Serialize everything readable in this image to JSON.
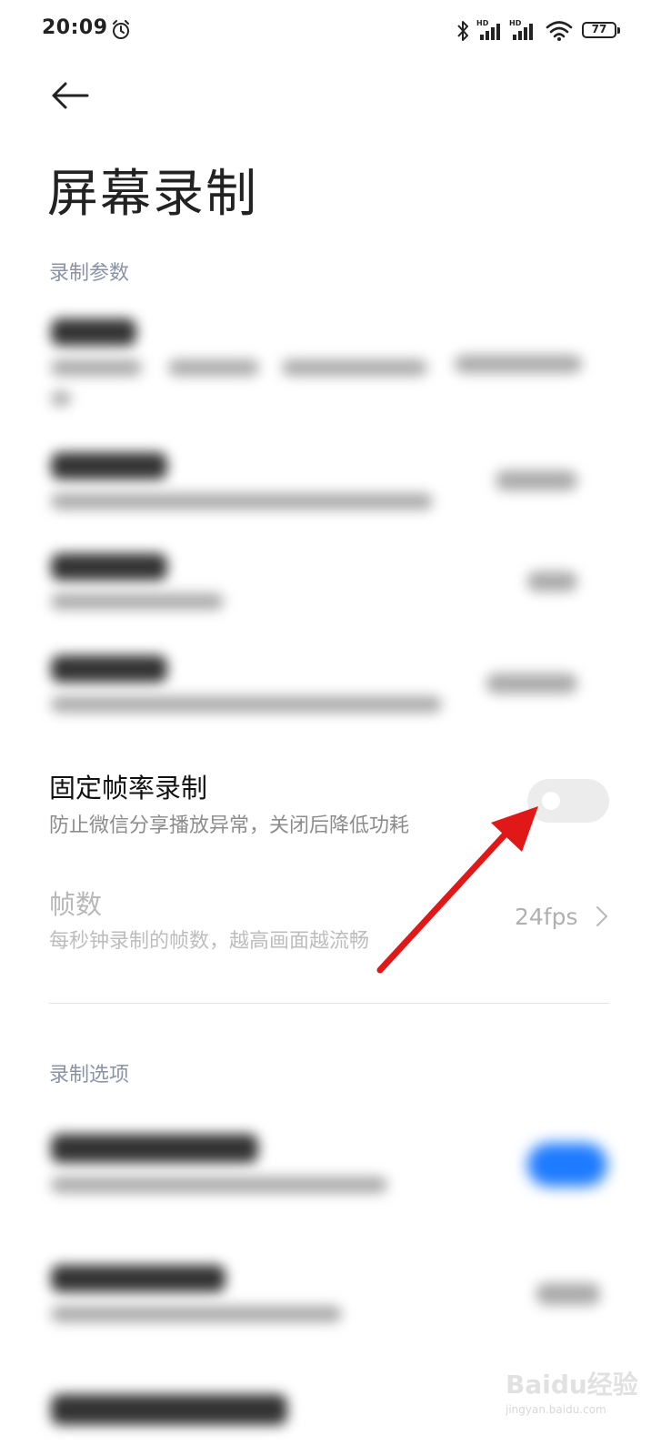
{
  "status_bar": {
    "time": "20:09",
    "battery_level": "77",
    "icons": [
      "alarm-icon",
      "bluetooth-icon",
      "signal-hd-icon",
      "signal-hd-icon",
      "wifi-icon",
      "battery-icon"
    ]
  },
  "header": {
    "back_icon": "arrow-left-icon",
    "title": "屏幕录制"
  },
  "sections": {
    "recording_params": "录制参数",
    "recording_options": "录制选项"
  },
  "fixed_frame_rate": {
    "title": "固定帧率录制",
    "subtitle": "防止微信分享播放异常，关闭后降低功耗",
    "toggle_on": false
  },
  "frame_count": {
    "title": "帧数",
    "subtitle": "每秒钟录制的帧数，越高画面越流畅",
    "value": "24fps",
    "enabled": false
  },
  "annotation": {
    "arrow_color": "#e01818"
  },
  "watermark": {
    "text": "Baidu经验",
    "subtext": "jingyan.baidu.com"
  },
  "colors": {
    "section_header": "#8a93a6",
    "toggle_off": "#ececec",
    "accent_blue": "#1e7bff"
  }
}
